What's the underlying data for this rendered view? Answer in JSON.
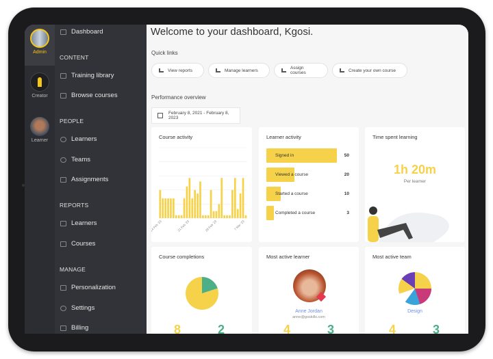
{
  "rail": [
    {
      "label": "Admin",
      "active": true
    },
    {
      "label": "Creator"
    },
    {
      "label": "Learner"
    }
  ],
  "nav": {
    "dashboard": "Dashboard",
    "sections": [
      {
        "title": "CONTENT",
        "items": [
          "Training library",
          "Browse courses"
        ]
      },
      {
        "title": "PEOPLE",
        "items": [
          "Learners",
          "Teams",
          "Assignments"
        ]
      },
      {
        "title": "REPORTS",
        "items": [
          "Learners",
          "Courses"
        ]
      },
      {
        "title": "MANAGE",
        "items": [
          "Personalization",
          "Settings",
          "Billing"
        ]
      }
    ]
  },
  "main": {
    "title": "Welcome to your dashboard, Kgosi.",
    "quick_links_label": "Quick links",
    "quick_links": [
      "View reports",
      "Manage learners",
      "Assign courses",
      "Create your own course"
    ],
    "performance_label": "Performance overview",
    "date_range": "February 8, 2021 - February 8, 2023"
  },
  "cards": {
    "course_activity": "Course activity",
    "learner_activity": "Learner activity",
    "time_spent": {
      "title": "Time spent learning",
      "value": "1h 20m",
      "sub": "Per learner"
    },
    "completions": {
      "title": "Course completions",
      "completed": "8",
      "other": "2"
    },
    "active_learner": {
      "title": "Most active learner",
      "name": "Anne Jordan",
      "email": "anne@goskills.com",
      "a": "4",
      "b": "3"
    },
    "active_team": {
      "title": "Most active team",
      "name": "Design",
      "a": "4",
      "b": "3"
    }
  },
  "colors": {
    "yellow": "#f5d24a",
    "green": "#4caf88",
    "link": "#6b8ff0"
  },
  "chart_data": [
    {
      "type": "bar",
      "title": "Course activity",
      "x_ticks": [
        "14 Feb '23",
        "21 Feb '23",
        "28 Feb '23",
        "7 Mar '23"
      ],
      "values": [
        2,
        1.4,
        1.4,
        1.4,
        1.4,
        1.4,
        0.2,
        0.2,
        0.2,
        1.4,
        2.25,
        2.85,
        1.4,
        2,
        1.75,
        2.6,
        0.2,
        0.2,
        0.2,
        2,
        0.5,
        0.5,
        1,
        2.85,
        0.2,
        0.2,
        0.2,
        2,
        2.85,
        0.65,
        1.75,
        2.85,
        0.2
      ],
      "ylim": [
        0,
        5
      ],
      "grid": true
    },
    {
      "type": "bar",
      "title": "Learner activity",
      "orientation": "horizontal",
      "categories": [
        "Signed in",
        "Viewed a course",
        "Started a course",
        "Completed a course"
      ],
      "values": [
        50,
        20,
        10,
        3
      ]
    },
    {
      "type": "pie",
      "title": "Course completions",
      "values": [
        8,
        2
      ]
    }
  ]
}
